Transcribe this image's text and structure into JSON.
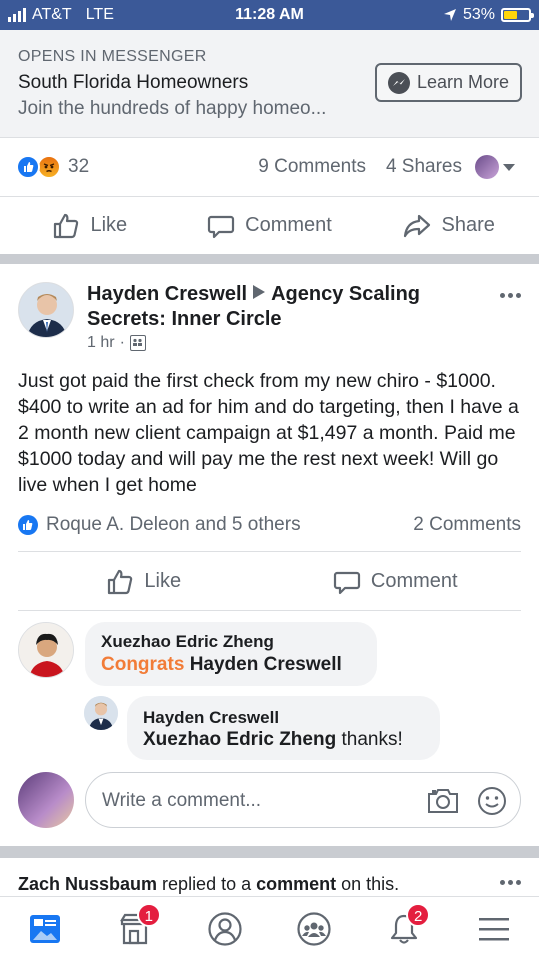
{
  "status_bar": {
    "carrier": "AT&T",
    "network": "LTE",
    "time": "11:28 AM",
    "battery": "53%",
    "battery_level": 0.53
  },
  "ad": {
    "kicker": "OPENS IN MESSENGER",
    "title": "South Florida Homeowners",
    "description": "Join the hundreds of happy homeo...",
    "cta_label": "Learn More"
  },
  "ad_stats": {
    "reaction_count": "32",
    "comments": "9 Comments",
    "shares": "4 Shares"
  },
  "ad_actions": {
    "like": "Like",
    "comment": "Comment",
    "share": "Share"
  },
  "post": {
    "author": "Hayden Creswell",
    "group": "Agency Scaling Secrets: Inner Circle",
    "time": "1 hr",
    "time_separator": "·",
    "body": "Just got paid the first check from my new chiro - $1000. $400 to write an ad for him and do targeting, then I have a 2 month new client campaign at $1,497 a month. Paid me $1000 today and will pay me the rest next week! Will go live when I get home",
    "likers": "Roque A. Deleon and 5 others",
    "comments": "2 Comments",
    "actions": {
      "like": "Like",
      "comment": "Comment"
    }
  },
  "comments": [
    {
      "name": "Xuezhao Edric Zheng",
      "highlight": "Congrats",
      "mention": "Hayden Creswell",
      "text": ""
    },
    {
      "name": "Hayden Creswell",
      "highlight": "",
      "mention": "Xuezhao Edric Zheng",
      "text": " thanks!"
    }
  ],
  "composer": {
    "placeholder": "Write a comment..."
  },
  "next_post": {
    "actor": "Zach Nussbaum",
    "verb": " replied to a ",
    "object": "comment",
    "suffix": " on this."
  },
  "tabbar": {
    "marketplace_badge": "1",
    "notifications_badge": "2"
  },
  "colors": {
    "brand_blue": "#3b5998",
    "like_blue": "#1877f2",
    "badge_red": "#e41e3f",
    "mention_orange": "#f27c38"
  }
}
